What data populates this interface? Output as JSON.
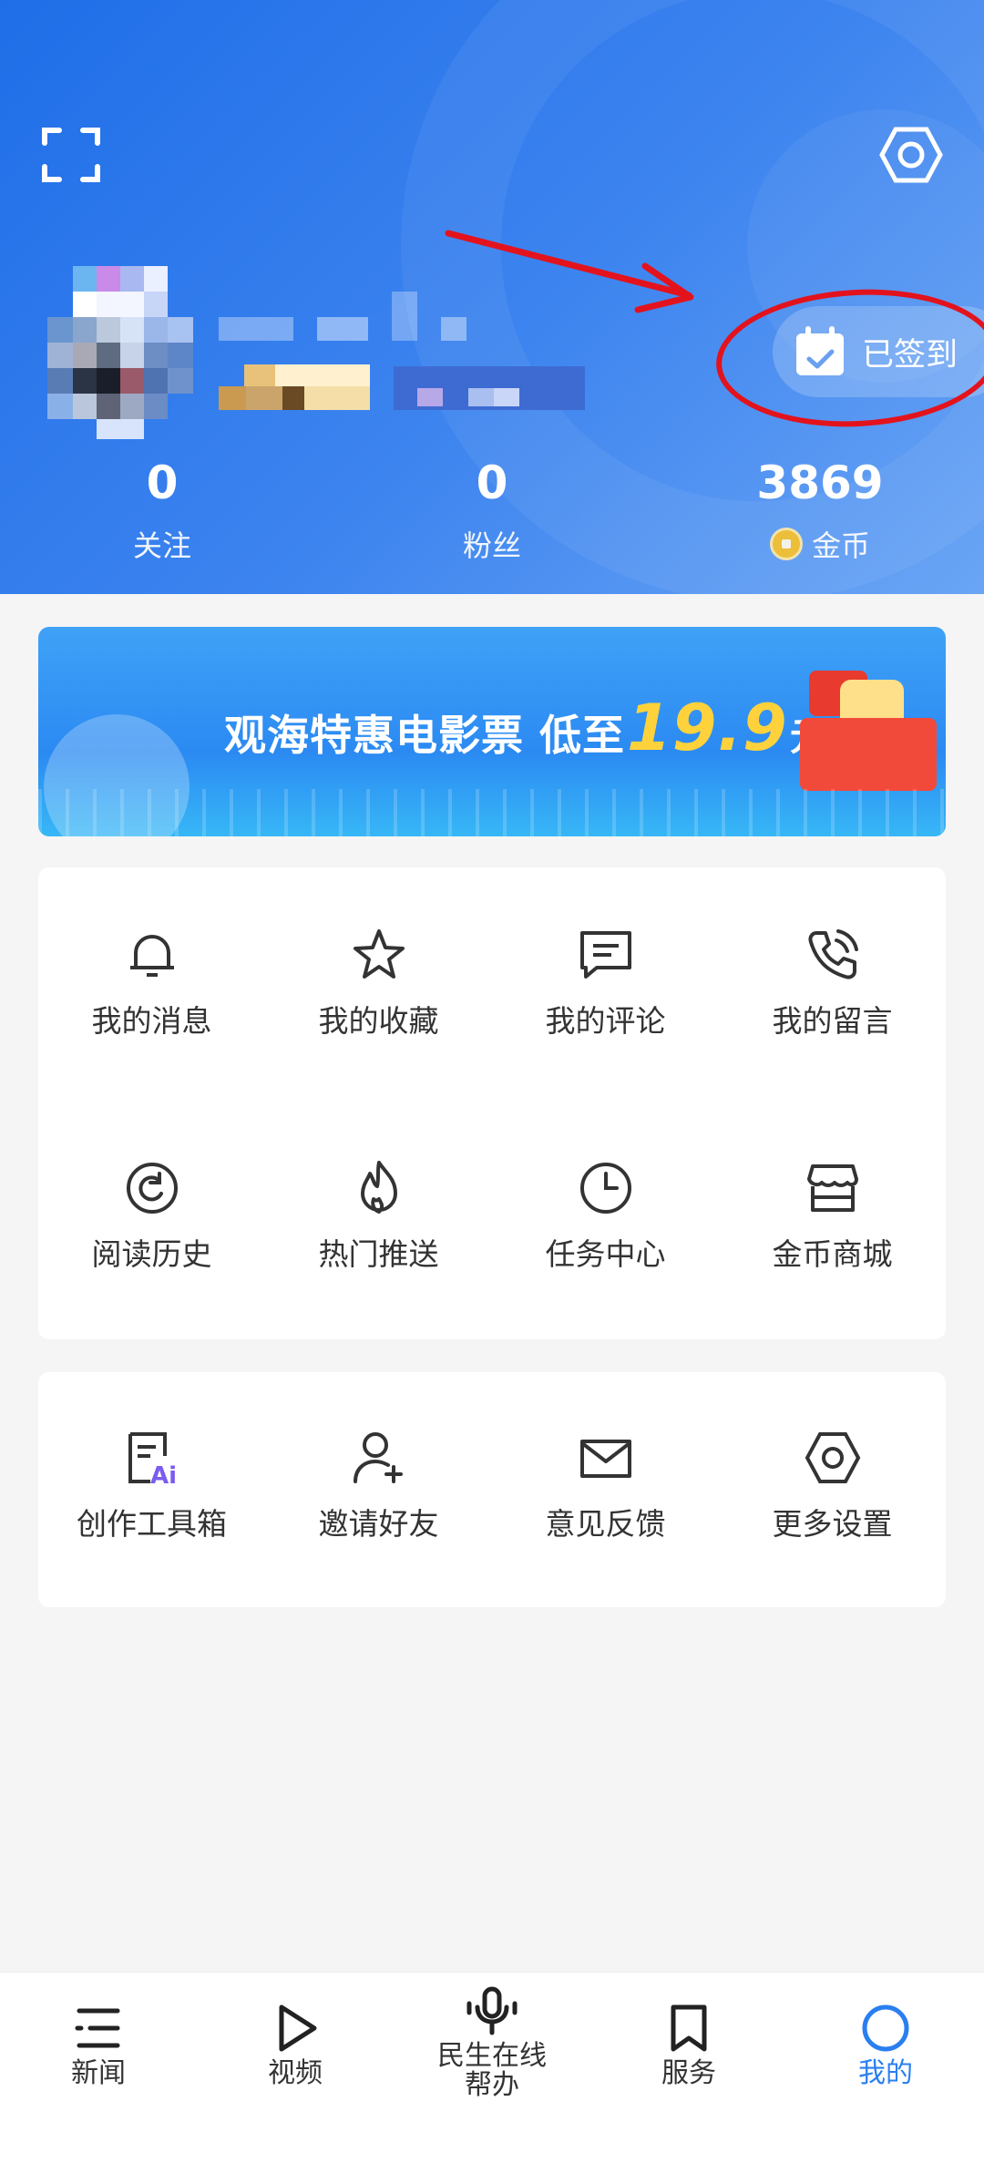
{
  "header": {
    "checkin_label": "已签到",
    "stats": [
      {
        "value": "0",
        "label": "关注"
      },
      {
        "value": "0",
        "label": "粉丝"
      },
      {
        "value": "3869",
        "label": "金币"
      }
    ]
  },
  "banner": {
    "title": "观海特惠电影票 低至",
    "price": "19.9",
    "unit": "元"
  },
  "menu_primary": [
    {
      "label": "我的消息",
      "icon": "bell-icon"
    },
    {
      "label": "我的收藏",
      "icon": "star-icon"
    },
    {
      "label": "我的评论",
      "icon": "comment-icon"
    },
    {
      "label": "我的留言",
      "icon": "phone-icon"
    },
    {
      "label": "阅读历史",
      "icon": "history-icon"
    },
    {
      "label": "热门推送",
      "icon": "flame-icon"
    },
    {
      "label": "任务中心",
      "icon": "clock-icon"
    },
    {
      "label": "金币商城",
      "icon": "store-icon"
    }
  ],
  "menu_secondary": [
    {
      "label": "创作工具箱",
      "icon": "ai-doc-icon"
    },
    {
      "label": "邀请好友",
      "icon": "add-user-icon"
    },
    {
      "label": "意见反馈",
      "icon": "mail-icon"
    },
    {
      "label": "更多设置",
      "icon": "hex-gear-icon"
    }
  ],
  "tabbar": [
    {
      "label": "新闻",
      "icon": "list-icon"
    },
    {
      "label": "视频",
      "icon": "play-icon"
    },
    {
      "label": "民生在线 帮办",
      "icon": "mic-icon"
    },
    {
      "label": "服务",
      "icon": "bookmark-icon"
    },
    {
      "label": "我的",
      "icon": "circle-icon",
      "active": true
    }
  ],
  "colors": {
    "header_start": "#1f6ee8",
    "header_end": "#6aa5f5",
    "accent": "#2a7ff0",
    "coin": "#f8c12a",
    "annotation": "#e3131d"
  }
}
